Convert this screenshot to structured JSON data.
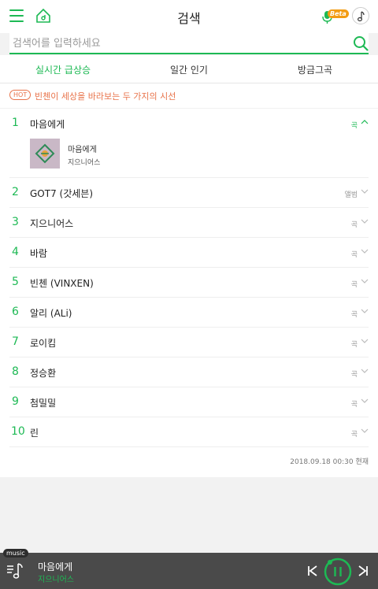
{
  "header": {
    "title": "검색",
    "beta_badge": "Beta"
  },
  "search": {
    "placeholder": "검색어를 입력하세요"
  },
  "tabs": [
    {
      "label": "실시간 급상승",
      "active": true
    },
    {
      "label": "일간 인기",
      "active": false
    },
    {
      "label": "방금그곡",
      "active": false
    }
  ],
  "hot": {
    "badge": "HOT",
    "text": "빈첸이 세상을 바라보는 두 가지의 시선"
  },
  "trending": [
    {
      "rank": "1",
      "title": "마음에게",
      "type": "곡",
      "expanded": true
    },
    {
      "rank": "2",
      "title": "GOT7 (갓세븐)",
      "type": "앨범"
    },
    {
      "rank": "3",
      "title": "지으니어스",
      "type": "곡"
    },
    {
      "rank": "4",
      "title": "바람",
      "type": "곡"
    },
    {
      "rank": "5",
      "title": "빈첸 (VINXEN)",
      "type": "곡"
    },
    {
      "rank": "6",
      "title": "알리 (ALi)",
      "type": "곡"
    },
    {
      "rank": "7",
      "title": "로이킴",
      "type": "곡"
    },
    {
      "rank": "8",
      "title": "정승환",
      "type": "곡"
    },
    {
      "rank": "9",
      "title": "첨밀밀",
      "type": "곡"
    },
    {
      "rank": "10",
      "title": "린",
      "type": "곡"
    }
  ],
  "expanded_item": {
    "title": "마음에게",
    "artist": "지으니어스"
  },
  "timestamp": "2018.09.18 00:30 현재",
  "player": {
    "label": "music",
    "title": "마음에게",
    "artist": "지으니어스"
  },
  "colors": {
    "accent": "#1db954",
    "hot": "#e8734a",
    "player_bg": "#4a4a4a"
  }
}
